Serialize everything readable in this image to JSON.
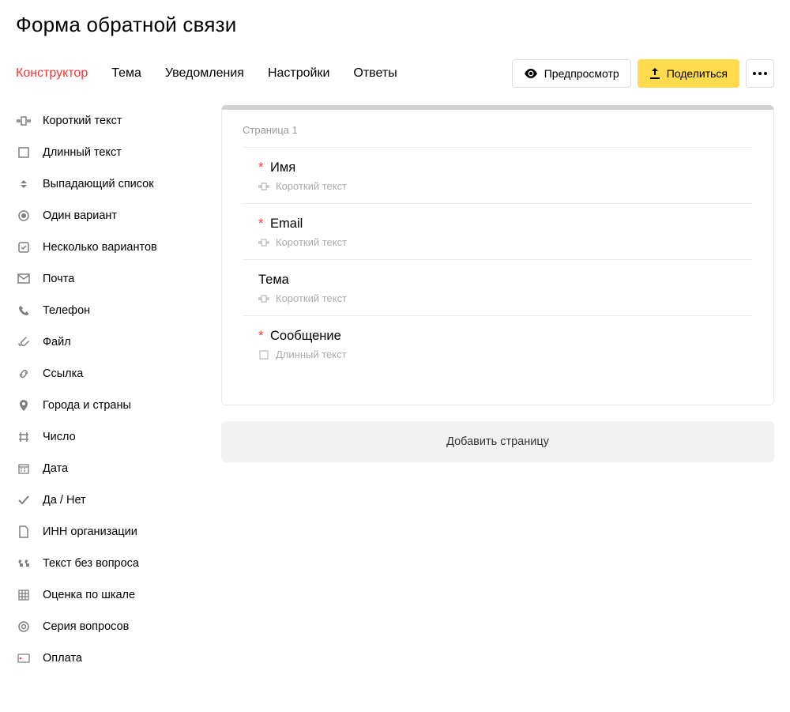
{
  "title": "Форма обратной связи",
  "tabs": {
    "constructor": "Конструктор",
    "theme": "Тема",
    "notifications": "Уведомления",
    "settings": "Настройки",
    "answers": "Ответы"
  },
  "actions": {
    "preview": "Предпросмотр",
    "share": "Поделиться"
  },
  "sidebar": {
    "short_text": "Короткий текст",
    "long_text": "Длинный текст",
    "dropdown": "Выпадающий список",
    "one_option": "Один вариант",
    "multi_option": "Несколько вариантов",
    "mail": "Почта",
    "phone": "Телефон",
    "file": "Файл",
    "link": "Ссылка",
    "cities": "Города и страны",
    "number": "Число",
    "date": "Дата",
    "yesno": "Да / Нет",
    "inn": "ИНН организации",
    "no_question": "Текст без вопроса",
    "scale": "Оценка по шкале",
    "series": "Серия вопросов",
    "payment": "Оплата"
  },
  "form": {
    "page_label": "Страница 1",
    "questions": [
      {
        "required": true,
        "title": "Имя",
        "type": "Короткий текст",
        "icon": "short"
      },
      {
        "required": true,
        "title": "Email",
        "type": "Короткий текст",
        "icon": "short"
      },
      {
        "required": false,
        "title": "Тема",
        "type": "Короткий текст",
        "icon": "short"
      },
      {
        "required": true,
        "title": "Сообщение",
        "type": "Длинный текст",
        "icon": "long"
      }
    ],
    "add_page": "Добавить страницу"
  }
}
